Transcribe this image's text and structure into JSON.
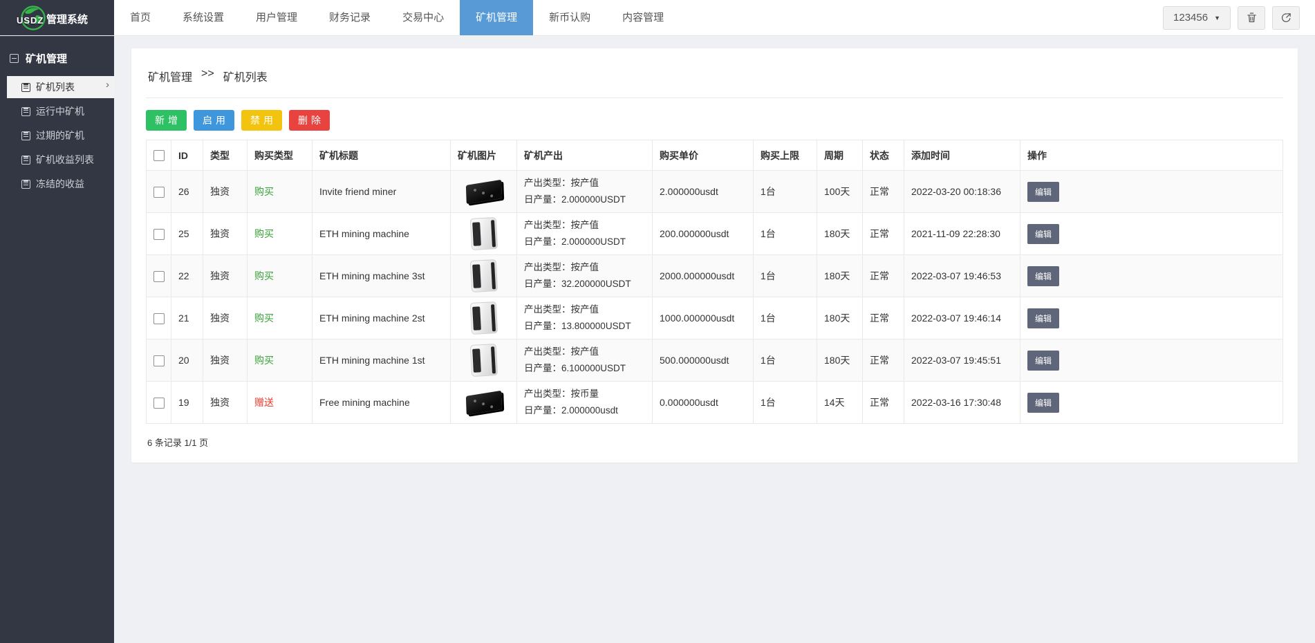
{
  "brand": {
    "logo_text": "USDZ",
    "title": "管理系统"
  },
  "topnav": {
    "items": [
      "首页",
      "系统设置",
      "用户管理",
      "财务记录",
      "交易中心",
      "矿机管理",
      "新币认购",
      "内容管理"
    ],
    "active": "矿机管理"
  },
  "user_menu": {
    "label": "123456",
    "caret_icon": "caret-down-icon"
  },
  "topbar_icons": [
    "trash-icon",
    "logout-icon"
  ],
  "sidebar": {
    "section": "矿机管理",
    "items": [
      "矿机列表",
      "运行中矿机",
      "过期的矿机",
      "矿机收益列表",
      "冻结的收益"
    ],
    "active": "矿机列表"
  },
  "breadcrumb": {
    "parent": "矿机管理",
    "separator": ">>",
    "current": "矿机列表"
  },
  "toolbar": {
    "add": "新增",
    "enable": "启用",
    "disable": "禁用",
    "delete": "删除"
  },
  "table": {
    "headers": [
      "ID",
      "类型",
      "购买类型",
      "矿机标题",
      "矿机图片",
      "矿机产出",
      "购买单价",
      "购买上限",
      "周期",
      "状态",
      "添加时间",
      "操作"
    ],
    "edit_label": "编辑",
    "rows": [
      {
        "id": "26",
        "type": "独资",
        "buy_type": "购买",
        "buy_color": "green",
        "title": "Invite friend miner",
        "machine": "black",
        "output_type": "产出类型：按产值",
        "daily_output": "日产量：2.000000USDT",
        "price": "2.000000usdt",
        "limit": "1台",
        "period": "100天",
        "status": "正常",
        "added": "2022-03-20 00:18:36"
      },
      {
        "id": "25",
        "type": "独资",
        "buy_type": "购买",
        "buy_color": "green",
        "title": "ETH mining machine",
        "machine": "white",
        "output_type": "产出类型：按产值",
        "daily_output": "日产量：2.000000USDT",
        "price": "200.000000usdt",
        "limit": "1台",
        "period": "180天",
        "status": "正常",
        "added": "2021-11-09 22:28:30"
      },
      {
        "id": "22",
        "type": "独资",
        "buy_type": "购买",
        "buy_color": "green",
        "title": "ETH mining machine 3st",
        "machine": "white",
        "output_type": "产出类型：按产值",
        "daily_output": "日产量：32.200000USDT",
        "price": "2000.000000usdt",
        "limit": "1台",
        "period": "180天",
        "status": "正常",
        "added": "2022-03-07 19:46:53"
      },
      {
        "id": "21",
        "type": "独资",
        "buy_type": "购买",
        "buy_color": "green",
        "title": "ETH mining machine 2st",
        "machine": "white",
        "output_type": "产出类型：按产值",
        "daily_output": "日产量：13.800000USDT",
        "price": "1000.000000usdt",
        "limit": "1台",
        "period": "180天",
        "status": "正常",
        "added": "2022-03-07 19:46:14"
      },
      {
        "id": "20",
        "type": "独资",
        "buy_type": "购买",
        "buy_color": "green",
        "title": "ETH mining machine 1st",
        "machine": "white",
        "output_type": "产出类型：按产值",
        "daily_output": "日产量：6.100000USDT",
        "price": "500.000000usdt",
        "limit": "1台",
        "period": "180天",
        "status": "正常",
        "added": "2022-03-07 19:45:51"
      },
      {
        "id": "19",
        "type": "独资",
        "buy_type": "赠送",
        "buy_color": "red",
        "title": "Free mining machine",
        "machine": "black",
        "output_type": "产出类型：按币量",
        "daily_output": "日产量：2.000000usdt",
        "price": "0.000000usdt",
        "limit": "1台",
        "period": "14天",
        "status": "正常",
        "added": "2022-03-16 17:30:48"
      }
    ]
  },
  "footer": {
    "summary": "6 条记录 1/1 页"
  },
  "colors": {
    "topbar_dark": "#333744",
    "nav_active": "#579ad6",
    "btn_add": "#2ec164",
    "btn_enable": "#3e97dd",
    "btn_disable": "#f2c40f",
    "btn_delete": "#e8433f",
    "buy_green": "#35a335",
    "gift_red": "#e8392c",
    "edit_btn": "#5f6679"
  }
}
